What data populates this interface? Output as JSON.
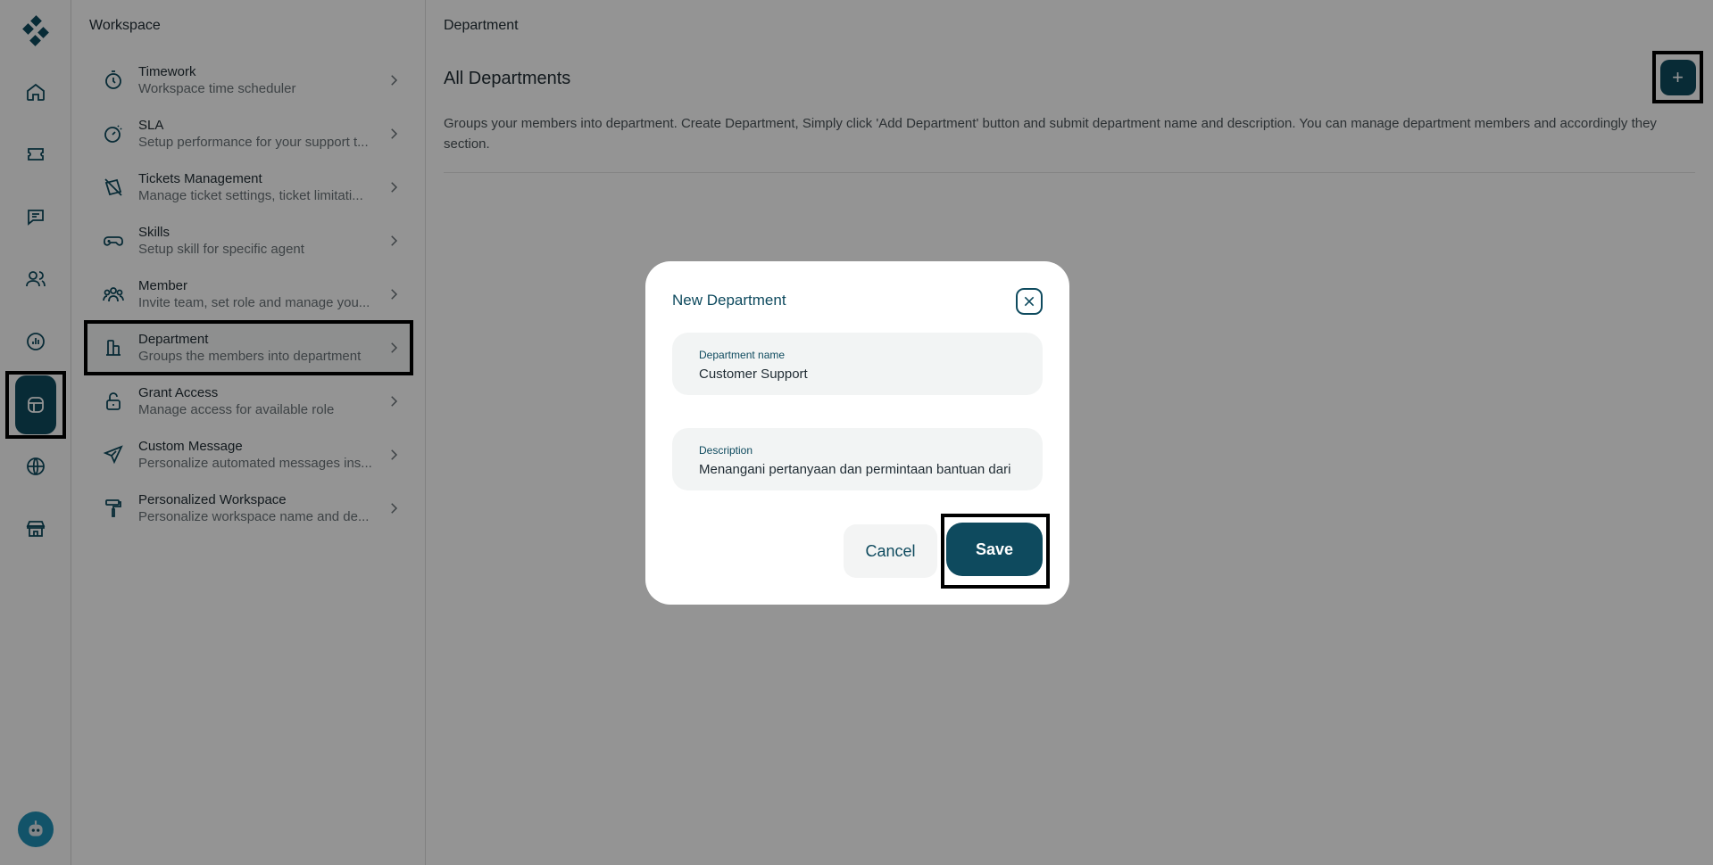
{
  "rail": {
    "items": [
      {
        "icon": "home-icon"
      },
      {
        "icon": "ticket-icon"
      },
      {
        "icon": "chat-icon"
      },
      {
        "icon": "users-icon"
      },
      {
        "icon": "report-icon"
      },
      {
        "icon": "workspace-icon",
        "active": true
      },
      {
        "icon": "globe-icon"
      },
      {
        "icon": "store-icon"
      }
    ]
  },
  "panel": {
    "title": "Workspace",
    "items": [
      {
        "label": "Timework",
        "desc": "Workspace time scheduler",
        "icon": "timer-icon"
      },
      {
        "label": "SLA",
        "desc": "Setup performance for your support t...",
        "icon": "sla-icon"
      },
      {
        "label": "Tickets Management",
        "desc": "Manage ticket settings, ticket limitati...",
        "icon": "ticket-settings-icon"
      },
      {
        "label": "Skills",
        "desc": "Setup skill for specific agent",
        "icon": "gamepad-icon"
      },
      {
        "label": "Member",
        "desc": "Invite team, set role and manage you...",
        "icon": "team-icon"
      },
      {
        "label": "Department",
        "desc": "Groups the members into department",
        "icon": "building-icon",
        "selected": true
      },
      {
        "label": "Grant Access",
        "desc": "Manage access for available role",
        "icon": "unlock-icon"
      },
      {
        "label": "Custom Message",
        "desc": "Personalize automated messages ins...",
        "icon": "send-icon"
      },
      {
        "label": "Personalized Workspace",
        "desc": "Personalize workspace name and de...",
        "icon": "paint-roller-icon"
      }
    ]
  },
  "main": {
    "breadcrumb": "Department",
    "title": "All Departments",
    "add_button": "+",
    "description": "Groups your members into department. Create Department, Simply click 'Add Department' button and submit department name and description. You can manage department members and accordingly they section."
  },
  "modal": {
    "title": "New Department",
    "name_label": "Department name",
    "name_value": "Customer Support",
    "desc_label": "Description",
    "desc_value": "Menangani pertanyaan dan permintaan bantuan dari",
    "cancel_label": "Cancel",
    "save_label": "Save"
  },
  "colors": {
    "accent": "#0e4a5e",
    "overlay": "rgba(0,0,0,0.42)"
  }
}
